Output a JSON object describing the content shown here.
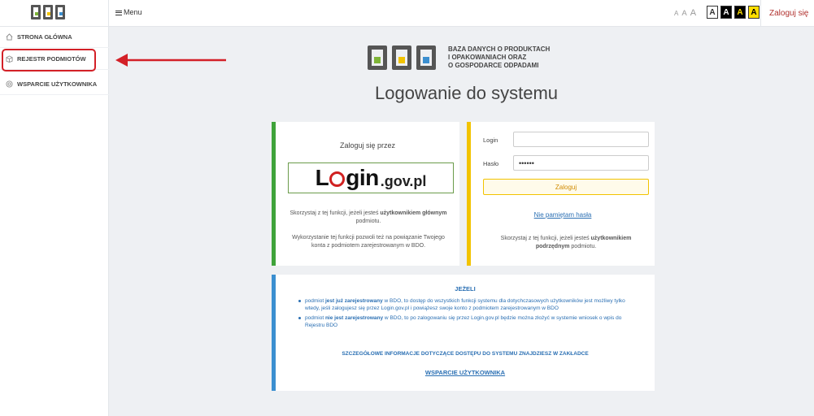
{
  "topbar": {
    "menu_label": "Menu",
    "font_sizes": [
      "A",
      "A",
      "A"
    ],
    "contrast_options": [
      "A",
      "A",
      "A",
      "A"
    ],
    "login_link": "Zaloguj się"
  },
  "sidebar": {
    "items": [
      {
        "label": "STRONA GŁÓWNA",
        "icon": "home-icon"
      },
      {
        "label": "REJESTR PODMIOTÓW",
        "icon": "box-icon"
      },
      {
        "label": "WSPARCIE UŻYTKOWNIKA",
        "icon": "help-icon"
      }
    ]
  },
  "header": {
    "org_name": [
      "BAZA DANYCH O PRODUKTACH",
      "I OPAKOWANIACH ORAZ",
      "O GOSPODARCE ODPADAMI"
    ],
    "title": "Logowanie do systemu"
  },
  "login_gov": {
    "title": "Zaloguj się przez",
    "brand_pre": "L",
    "brand_mid": "gin",
    "brand_suffix": ".gov.pl",
    "desc1_a": "Skorzystaj z tej funkcji, jeżeli jesteś ",
    "desc1_b": "użytkownikiem głównym",
    "desc1_c": " podmiotu.",
    "desc2": "Wykorzystanie tej funkcji pozwoli też na powiązanie Twojego konta z podmiotem zarejestrowanym w BDO."
  },
  "login_form": {
    "login_label": "Login",
    "login_value": "",
    "password_label": "Hasło",
    "password_value": "••••••",
    "submit": "Zaloguj",
    "forgot": "Nie pamiętam hasła",
    "desc_a": "Skorzystaj z tej funkcji, jeżeli jesteś ",
    "desc_b": "użytkownikiem podrzędnym",
    "desc_c": " podmiotu."
  },
  "info": {
    "title": "JEŻELI",
    "item1_a": "podmiot ",
    "item1_b": "jest już zarejestrowany",
    "item1_c": " w BDO, to dostęp do wszystkich funkcji systemu dla dotychczasowych użytkowników jest możliwy tylko wtedy, jeśli zalogujesz się przez Login.gov.pl i powiążesz swoje konto z podmiotem zarejestrowanym w BDO",
    "item2_a": "podmiot ",
    "item2_b": "nie jest zarejestrowany",
    "item2_c": " w BDO, to po zalogowaniu się przez Login.gov.pl będzie można złożyć w systemie wniosek o wpis do Rejestru BDO",
    "footer": "SZCZEGÓŁOWE INFORMACJE DOTYCZĄCE DOSTĘPU DO SYSTEMU ZNAJDZIESZ W ZAKŁADCE",
    "link": "WSPARCIE UŻYTKOWNIKA"
  },
  "colors": {
    "accent_red": "#d32027",
    "green": "#3fa33a",
    "yellow": "#f2c300",
    "blue": "#3b8fd0"
  }
}
